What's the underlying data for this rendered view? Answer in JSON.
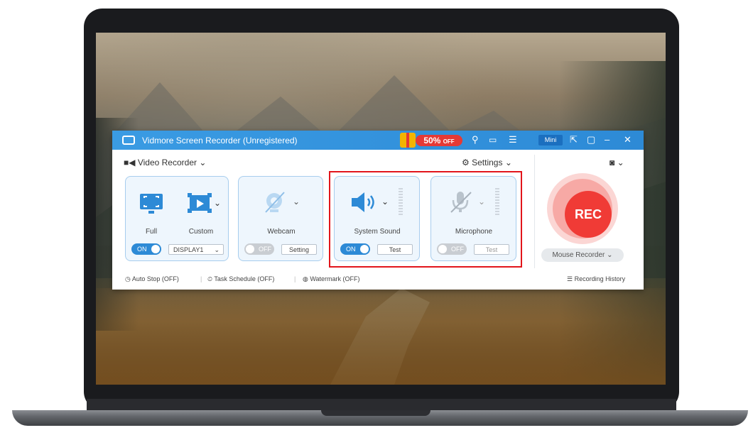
{
  "app": {
    "title": "Vidmore Screen Recorder (Unregistered)",
    "promo": {
      "percent": "50%",
      "off": "OFF"
    },
    "mini_label": "Mini"
  },
  "toolbar": {
    "mode_label": "Video Recorder",
    "settings_label": "Settings"
  },
  "display": {
    "full_label": "Full",
    "custom_label": "Custom",
    "toggle": "ON",
    "select_value": "DISPLAY1"
  },
  "webcam": {
    "label": "Webcam",
    "toggle": "OFF",
    "button": "Setting"
  },
  "system_sound": {
    "label": "System Sound",
    "toggle": "ON",
    "button": "Test"
  },
  "microphone": {
    "label": "Microphone",
    "toggle": "OFF",
    "button": "Test"
  },
  "record": {
    "label": "REC",
    "mouse_recorder": "Mouse Recorder"
  },
  "footer": {
    "auto_stop": "Auto Stop (OFF)",
    "task_schedule": "Task Schedule (OFF)",
    "watermark": "Watermark (OFF)",
    "history": "Recording History"
  },
  "colors": {
    "accent": "#2d8ad6",
    "rec": "#f03b36",
    "highlight": "#e2151b"
  },
  "icons": [
    "monitor-icon",
    "webcam-icon",
    "speaker-icon",
    "microphone-icon",
    "camera-icon",
    "gear-icon",
    "clock-icon",
    "timer-icon",
    "watermark-icon",
    "list-icon"
  ]
}
